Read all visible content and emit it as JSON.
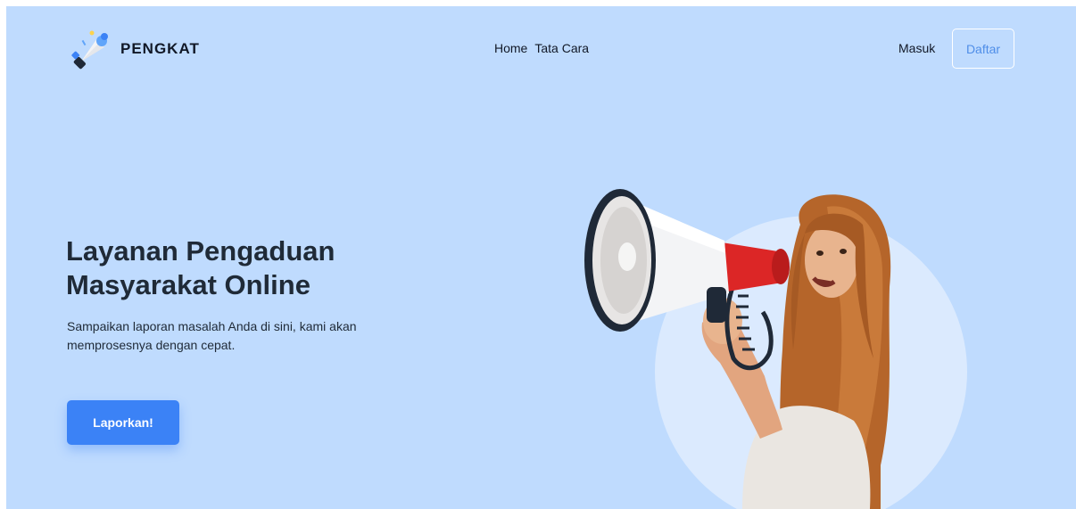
{
  "brand": {
    "name": "PENGKAT",
    "logo_icon": "megaphone-logo-icon"
  },
  "nav": {
    "links": [
      {
        "label": "Home"
      },
      {
        "label": "Tata Cara"
      }
    ],
    "login_label": "Masuk",
    "register_label": "Daftar"
  },
  "hero": {
    "title": "Layanan Pengaduan Masyarakat Online",
    "subtitle": "Sampaikan laporan masalah Anda di sini, kami akan memprosesnya dengan cepat.",
    "cta_label": "Laporkan!",
    "image": "woman-with-megaphone-illustration"
  },
  "colors": {
    "background": "#bfdbfe",
    "accent": "#3b82f6",
    "text": "#1f2a37",
    "register_text": "#4f8ee8"
  }
}
